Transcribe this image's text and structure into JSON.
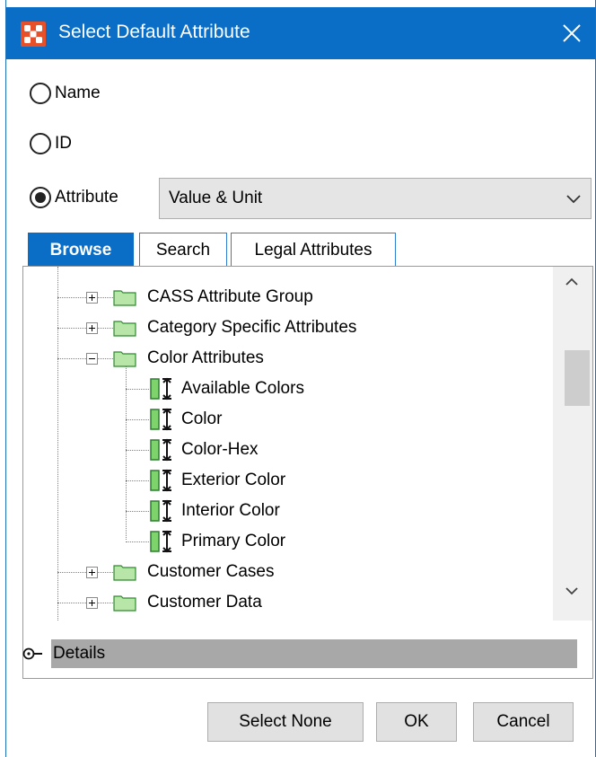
{
  "window": {
    "title": "Select Default Attribute",
    "accent_color": "#0a6ec7",
    "app_icon": "app-logo-icon",
    "close_icon": "close-icon"
  },
  "options": {
    "name_label": "Name",
    "id_label": "ID",
    "attribute_label": "Attribute",
    "selected": "Attribute"
  },
  "attribute_select": {
    "value": "Value & Unit"
  },
  "tabs": [
    {
      "label": "Browse",
      "active": true
    },
    {
      "label": "Search",
      "active": false
    },
    {
      "label": "Legal Attributes",
      "active": false
    }
  ],
  "tree": {
    "nodes": [
      {
        "label": "CASS Attribute Group",
        "type": "folder",
        "expanded": false
      },
      {
        "label": "Category Specific Attributes",
        "type": "folder",
        "expanded": false
      },
      {
        "label": "Color Attributes",
        "type": "folder",
        "expanded": true
      },
      {
        "label": "Available Colors",
        "type": "attribute"
      },
      {
        "label": "Color",
        "type": "attribute"
      },
      {
        "label": "Color-Hex",
        "type": "attribute"
      },
      {
        "label": "Exterior Color",
        "type": "attribute"
      },
      {
        "label": "Interior Color",
        "type": "attribute"
      },
      {
        "label": "Primary Color",
        "type": "attribute"
      },
      {
        "label": "Customer Cases",
        "type": "folder",
        "expanded": false
      },
      {
        "label": "Customer Data",
        "type": "folder",
        "expanded": false
      }
    ]
  },
  "details": {
    "label": "Details"
  },
  "buttons": {
    "select_none": "Select None",
    "ok": "OK",
    "cancel": "Cancel"
  }
}
